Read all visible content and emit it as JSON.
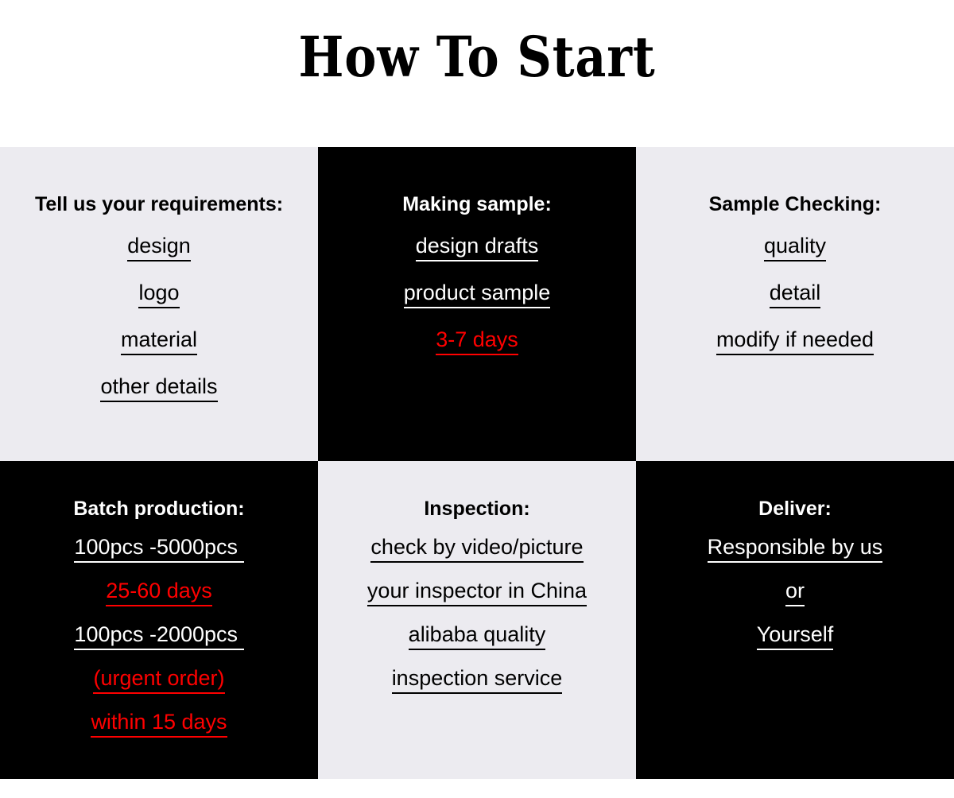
{
  "title": "How To Start",
  "colors": {
    "light_cell_bg": "#ecebf0",
    "dark_cell_bg": "#000000",
    "page_bg": "#ffffff",
    "accent_red": "#ff0000",
    "text_dark": "#000000",
    "text_light": "#ffffff"
  },
  "grid": {
    "columns": 3,
    "rows": 2,
    "cells": [
      {
        "id": "tell-us-your-requirements",
        "theme": "light",
        "heading": "Tell us your requirements:",
        "items": [
          {
            "text": "design",
            "color": "default"
          },
          {
            "text": "logo",
            "color": "default"
          },
          {
            "text": "material",
            "color": "default"
          },
          {
            "text": "other details",
            "color": "default"
          }
        ]
      },
      {
        "id": "making-sample",
        "theme": "dark",
        "heading": "Making sample:",
        "items": [
          {
            "text": "design drafts",
            "color": "default"
          },
          {
            "text": "product sample",
            "color": "default"
          },
          {
            "text": "3-7 days",
            "color": "red"
          }
        ]
      },
      {
        "id": "sample-checking",
        "theme": "light",
        "heading": "Sample Checking:",
        "items": [
          {
            "text": "quality",
            "color": "default"
          },
          {
            "text": "detail",
            "color": "default"
          },
          {
            "text": "modify if needed",
            "color": "default"
          }
        ]
      },
      {
        "id": "batch-production",
        "theme": "dark",
        "heading": "Batch production:",
        "items": [
          {
            "text": "100pcs -5000pcs ",
            "color": "default"
          },
          {
            "text": "25-60 days",
            "color": "red"
          },
          {
            "text": "100pcs -2000pcs ",
            "color": "default"
          },
          {
            "text": "(urgent order)",
            "color": "red"
          },
          {
            "text": "within 15 days",
            "color": "red"
          }
        ]
      },
      {
        "id": "inspection",
        "theme": "light",
        "heading": "Inspection:",
        "items": [
          {
            "text": "check by video/picture",
            "color": "default"
          },
          {
            "text": "your inspector in China",
            "color": "default"
          },
          {
            "text": "alibaba quality",
            "color": "default"
          },
          {
            "text": "inspection service",
            "color": "default"
          }
        ]
      },
      {
        "id": "deliver",
        "theme": "dark",
        "heading": "Deliver:",
        "items": [
          {
            "text": "Responsible by us",
            "color": "default"
          },
          {
            "text": "or",
            "color": "default"
          },
          {
            "text": "Yourself",
            "color": "default"
          }
        ]
      }
    ]
  }
}
